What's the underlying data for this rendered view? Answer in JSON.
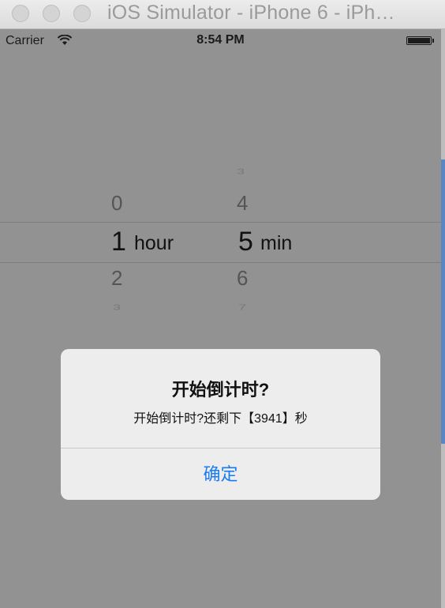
{
  "window": {
    "title": "iOS Simulator - iPhone 6 - iPh…"
  },
  "status_bar": {
    "carrier": "Carrier",
    "time": "8:54 PM"
  },
  "picker": {
    "hours": {
      "above_far": "",
      "above": "0",
      "selected": "1",
      "below": "2",
      "below_far": "3",
      "unit": "hour"
    },
    "minutes": {
      "above_far": "3",
      "above": "4",
      "selected": "5",
      "below": "6",
      "below_far": "7",
      "unit": "min"
    }
  },
  "alert": {
    "title": "开始倒计时?",
    "message": "开始倒计时?还剩下【3941】秒",
    "button_label": "确定"
  },
  "colors": {
    "dim_overlay": "#929292",
    "alert_button": "#1a7cf2"
  }
}
